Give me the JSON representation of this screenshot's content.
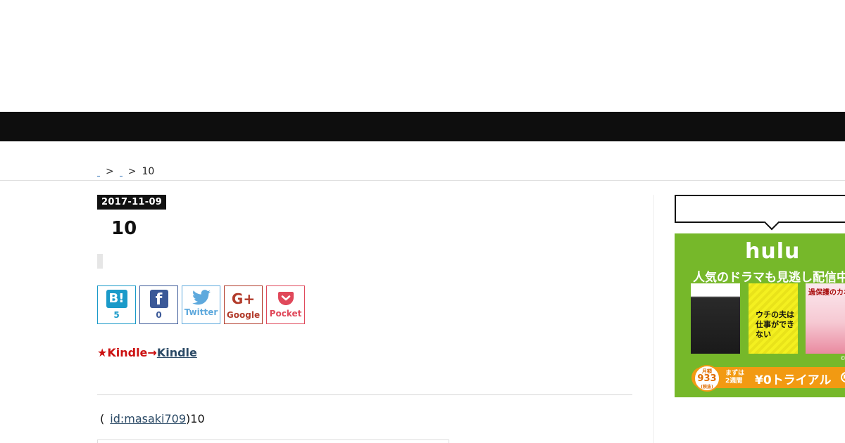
{
  "header": {
    "nav_background": "#0e0e0e"
  },
  "breadcrumb": {
    "separator": ">",
    "current": "10"
  },
  "entry": {
    "date": "2017-11-09",
    "title": "10",
    "kindle_prefix": "★Kindle→",
    "kindle_link": "Kindle",
    "author_prefix": "(",
    "author_id": "id:masaki709",
    "author_suffix": ")10"
  },
  "share": {
    "hatena": {
      "icon": "B!",
      "count": "5",
      "color": "#1a9ac9"
    },
    "facebook": {
      "icon": "f",
      "count": "0",
      "color": "#3b5998"
    },
    "twitter": {
      "label": "Twitter",
      "color": "#5ea9dd"
    },
    "google": {
      "icon": "G+",
      "label": "Google",
      "color": "#b23b2b"
    },
    "pocket": {
      "label": "Pocket",
      "color": "#e0485a"
    }
  },
  "sidebar": {
    "ad": {
      "logo": "hulu",
      "tagline": "人気のドラマも見逃し配信中",
      "poster2_text_line1": "ウチの夫は",
      "poster2_text_line2": "仕事ができない",
      "poster3_text": "過保護のカホコ",
      "copyright": "©",
      "price_top": "月額",
      "price": "933",
      "price_bottom": "(税抜)",
      "trial_sub_line1": "まずは",
      "trial_sub_line2": "2週間",
      "trial_main": "¥0トライアル",
      "background": "#76b82a",
      "button_color": "#f29a12"
    }
  }
}
